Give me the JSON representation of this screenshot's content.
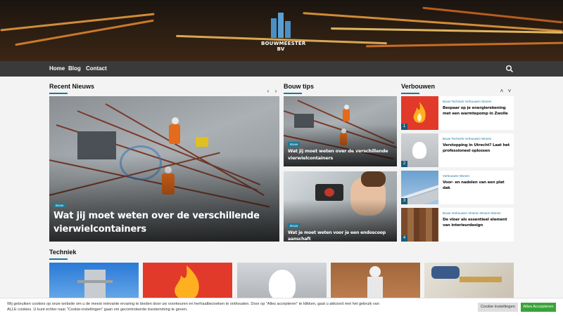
{
  "header": {
    "logo_text": "BOUWMEESTER BV"
  },
  "nav": {
    "items": [
      "Home",
      "Blog",
      "Contact"
    ]
  },
  "recent": {
    "title": "Recent Nieuws",
    "category": "Bouw",
    "headline": "Wat jij moet weten over de verschillende vierwielcontainers"
  },
  "tips": {
    "title": "Bouw tips",
    "cards": [
      {
        "category": "Bouw",
        "headline": "Wat jij moet weten over de verschillende vierwielcontainers"
      },
      {
        "category": "Bouw",
        "headline": "Wat je moet weten voor je een endoscoop aanschaft"
      }
    ]
  },
  "verbouwen": {
    "title": "Verbouwen",
    "items": [
      {
        "num": "1",
        "cats": "Bouw  Techniek  Verbouwen  Wonen",
        "title": "Bespaar op je energierekening met een warmtepomp in Zwolle",
        "thumb_color": "#e23a2a"
      },
      {
        "num": "2",
        "cats": "Bouw  Techniek  Verbouwen  Wonen",
        "title": "Verstopping in Utrecht? Laat het professioneel oplossen",
        "thumb_color": "#c9ccd0"
      },
      {
        "num": "3",
        "cats": "Verbouwen  Wonen",
        "title": "Voor- en nadelen van een plat dak",
        "thumb_color": "#5a8fc0"
      },
      {
        "num": "4",
        "cats": "Bouw  Verbouwen  Vloeren  Wonen  Wonen",
        "title": "De vloer als essentieel element van interieurdesign",
        "thumb_color": "#8a5a3a"
      }
    ]
  },
  "techniek": {
    "title": "Techniek"
  },
  "cookie": {
    "text": "Wij gebruiken cookies op onze website om u de meest relevante ervaring te bieden door uw voorkeuren en herhaalbezoeken te onthouden. Door op \"Alles accepteren\" te klikken, gaat u akkoord met het gebruik van ALLE cookies. U kunt echter naar \"Cookie-instellingen\" gaan om gecontroleerde toestemming te geven.",
    "settings_label": "Cookie Instellingen",
    "accept_label": "Alles Accepteren"
  },
  "colors": {
    "accent": "#1a7a9a",
    "nav_bg": "#3a3a3a",
    "accept_green": "#3aa33a"
  }
}
